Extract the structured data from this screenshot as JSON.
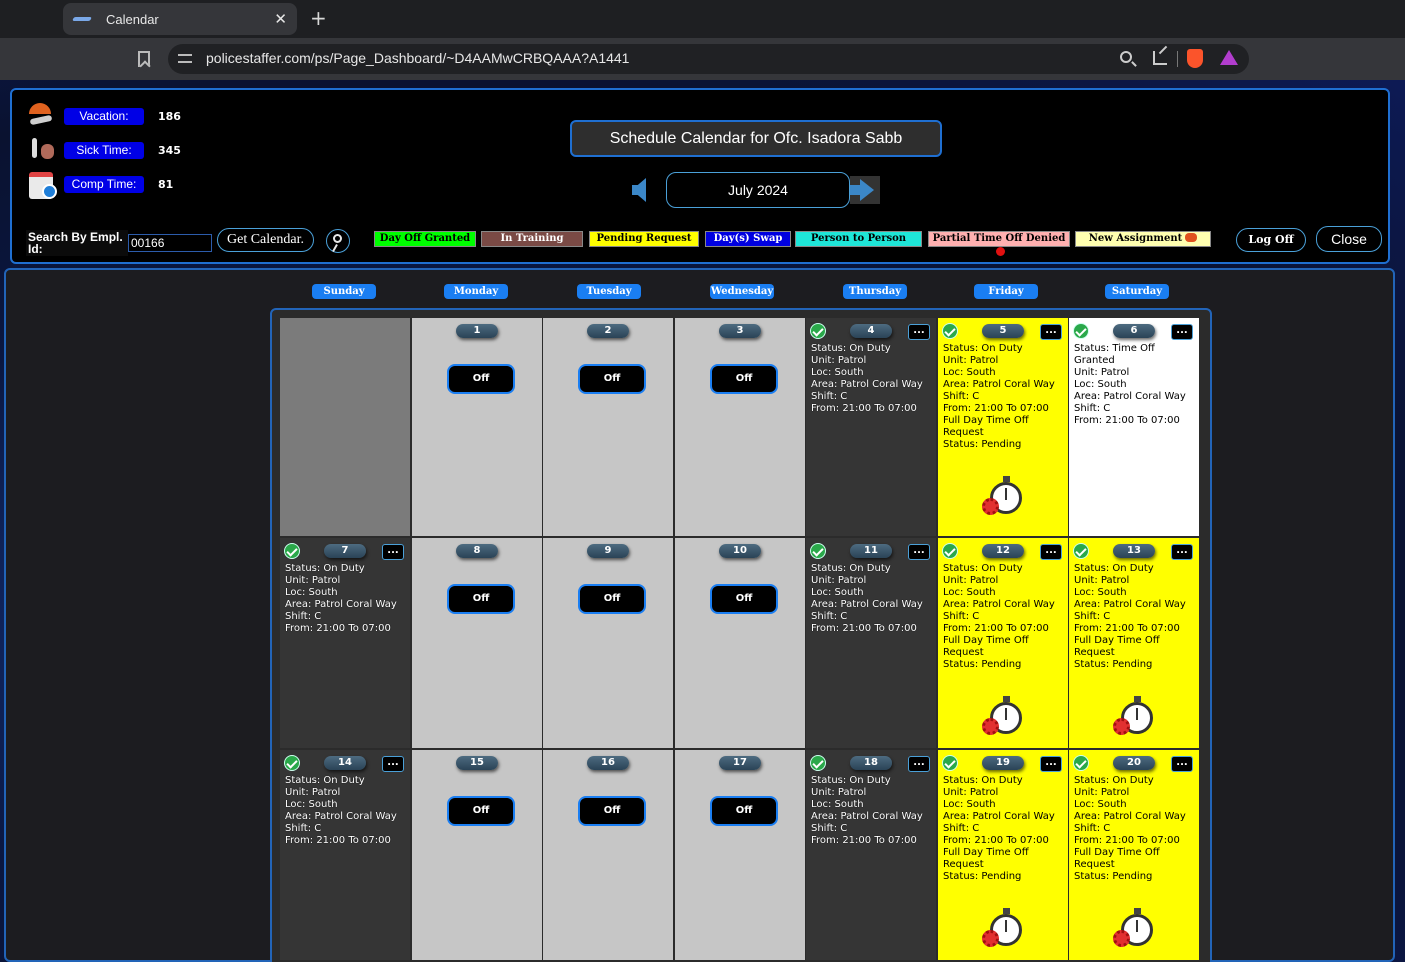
{
  "browser": {
    "tab_title": "Calendar",
    "new_tab": "+",
    "tab_close": "✕",
    "url": "policestaffer.com/ps/Page_Dashboard/~D4AAMwCRBQAAA?A1441"
  },
  "balances": [
    {
      "label": "Vacation:",
      "value": "186",
      "icon": "umbrella-icon"
    },
    {
      "label": "Sick Time:",
      "value": "345",
      "icon": "thermometer-icon"
    },
    {
      "label": "Comp Time:",
      "value": "81",
      "icon": "calendar-clock-icon"
    }
  ],
  "title": "Schedule Calendar for Ofc. Isadora Sabb",
  "month": "July 2024",
  "search": {
    "label": "Search By Empl. Id:",
    "value": "00166",
    "button": "Get Calendar."
  },
  "legend": [
    {
      "label": "Day Off Granted",
      "bg": "#00ff00",
      "color": "#000000"
    },
    {
      "label": "In Training",
      "bg": "#7a4a45",
      "color": "#ffffff"
    },
    {
      "label": "Pending Request",
      "bg": "#ffff00",
      "color": "#000000"
    },
    {
      "label": "Day(s) Swap",
      "bg": "#0000e0",
      "color": "#ffffff"
    },
    {
      "label": "Person to Person Swap",
      "bg": "#1ee6d8",
      "color": "#000000"
    },
    {
      "label": "Partial Time Off Denied",
      "bg": "#ffb0b0",
      "color": "#000000"
    },
    {
      "label": "New Assignment",
      "bg": "#ffffb0",
      "color": "#000000"
    }
  ],
  "actions": {
    "logoff": "Log Off",
    "close": "Close"
  },
  "day_names": [
    "Sunday",
    "Monday",
    "Tuesday",
    "Wednesday",
    "Thursday",
    "Friday",
    "Saturday"
  ],
  "off_label": "Off",
  "more_label": "...",
  "weeks": [
    [
      {
        "type": "empty"
      },
      {
        "type": "off",
        "date": "1"
      },
      {
        "type": "off",
        "date": "2"
      },
      {
        "type": "off",
        "date": "3"
      },
      {
        "type": "duty",
        "date": "4",
        "lines": [
          "Status: On Duty",
          "Unit: Patrol",
          "Loc: South",
          "Area: Patrol Coral Way",
          "Shift: C",
          "From: 21:00 To 07:00"
        ]
      },
      {
        "type": "pending",
        "date": "5",
        "lines": [
          "Status: On Duty",
          "Unit: Patrol",
          "Loc: South",
          "Area: Patrol Coral Way",
          "Shift: C",
          "From: 21:00 To 07:00",
          "Full Day Time Off",
          "Request",
          "Status: Pending"
        ]
      },
      {
        "type": "granted",
        "date": "6",
        "lines": [
          "Status: Time Off",
          "Granted",
          "Unit: Patrol",
          "Loc: South",
          "Area: Patrol Coral Way",
          "Shift: C",
          "From: 21:00 To 07:00"
        ]
      }
    ],
    [
      {
        "type": "duty",
        "date": "7",
        "lines": [
          "Status: On Duty",
          "Unit: Patrol",
          "Loc: South",
          "Area: Patrol Coral Way",
          "Shift: C",
          "From: 21:00 To 07:00"
        ]
      },
      {
        "type": "off",
        "date": "8"
      },
      {
        "type": "off",
        "date": "9"
      },
      {
        "type": "off",
        "date": "10"
      },
      {
        "type": "duty",
        "date": "11",
        "lines": [
          "Status: On Duty",
          "Unit: Patrol",
          "Loc: South",
          "Area: Patrol Coral Way",
          "Shift: C",
          "From: 21:00 To 07:00"
        ]
      },
      {
        "type": "pending",
        "date": "12",
        "lines": [
          "Status: On Duty",
          "Unit: Patrol",
          "Loc: South",
          "Area: Patrol Coral Way",
          "Shift: C",
          "From: 21:00 To 07:00",
          "Full Day Time Off",
          "Request",
          "Status: Pending"
        ]
      },
      {
        "type": "pending",
        "date": "13",
        "lines": [
          "Status: On Duty",
          "Unit: Patrol",
          "Loc: South",
          "Area: Patrol Coral Way",
          "Shift: C",
          "From: 21:00 To 07:00",
          "Full Day Time Off",
          "Request",
          "Status: Pending"
        ]
      }
    ],
    [
      {
        "type": "duty",
        "date": "14",
        "lines": [
          "Status: On Duty",
          "Unit: Patrol",
          "Loc: South",
          "Area: Patrol Coral Way",
          "Shift: C",
          "From: 21:00 To 07:00"
        ]
      },
      {
        "type": "off",
        "date": "15"
      },
      {
        "type": "off",
        "date": "16"
      },
      {
        "type": "off",
        "date": "17"
      },
      {
        "type": "duty",
        "date": "18",
        "lines": [
          "Status: On Duty",
          "Unit: Patrol",
          "Loc: South",
          "Area: Patrol Coral Way",
          "Shift: C",
          "From: 21:00 To 07:00"
        ]
      },
      {
        "type": "pending",
        "date": "19",
        "lines": [
          "Status: On Duty",
          "Unit: Patrol",
          "Loc: South",
          "Area: Patrol Coral Way",
          "Shift: C",
          "From: 21:00 To 07:00",
          "Full Day Time Off",
          "Request",
          "Status: Pending"
        ]
      },
      {
        "type": "pending",
        "date": "20",
        "lines": [
          "Status: On Duty",
          "Unit: Patrol",
          "Loc: South",
          "Area: Patrol Coral Way",
          "Shift: C",
          "From: 21:00 To 07:00",
          "Full Day Time Off",
          "Request",
          "Status: Pending"
        ]
      }
    ]
  ]
}
